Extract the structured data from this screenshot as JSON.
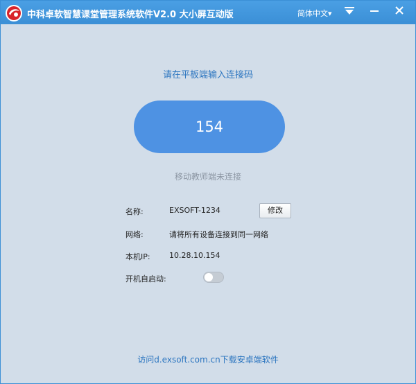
{
  "titlebar": {
    "title": "中科卓软智慧课堂管理系统软件V2.0 大小屏互动版",
    "language_selector": "简体中文▾",
    "icons": [
      "logo-icon",
      "dropdown-menu-icon",
      "minimize-icon",
      "close-icon"
    ]
  },
  "main": {
    "prompt": "请在平板端输入连接码",
    "connection_code": "154",
    "status": "移动教师端未连接"
  },
  "info": {
    "name_label": "名称:",
    "name_value": "EXSOFT-1234",
    "edit_button": "修改",
    "network_label": "网络:",
    "network_value": "请将所有设备连接到同一网络",
    "ip_label": "本机IP:",
    "ip_value": "10.28.10.154",
    "autostart_label": "开机自启动:",
    "autostart_enabled": false
  },
  "footer": {
    "download_link": "访问d.exsoft.com.cn下载安卓端软件"
  },
  "colors": {
    "titlebar": "#3b8fd6",
    "background": "#d2dde9",
    "accent": "#4e92e3",
    "link": "#2d76c0"
  }
}
